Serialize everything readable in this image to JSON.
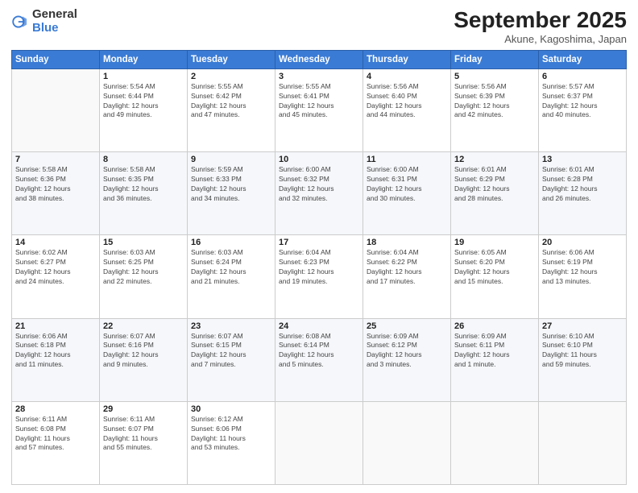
{
  "logo": {
    "general": "General",
    "blue": "Blue"
  },
  "title": "September 2025",
  "subtitle": "Akune, Kagoshima, Japan",
  "weekdays": [
    "Sunday",
    "Monday",
    "Tuesday",
    "Wednesday",
    "Thursday",
    "Friday",
    "Saturday"
  ],
  "weeks": [
    [
      {
        "day": "",
        "info": ""
      },
      {
        "day": "1",
        "info": "Sunrise: 5:54 AM\nSunset: 6:44 PM\nDaylight: 12 hours\nand 49 minutes."
      },
      {
        "day": "2",
        "info": "Sunrise: 5:55 AM\nSunset: 6:42 PM\nDaylight: 12 hours\nand 47 minutes."
      },
      {
        "day": "3",
        "info": "Sunrise: 5:55 AM\nSunset: 6:41 PM\nDaylight: 12 hours\nand 45 minutes."
      },
      {
        "day": "4",
        "info": "Sunrise: 5:56 AM\nSunset: 6:40 PM\nDaylight: 12 hours\nand 44 minutes."
      },
      {
        "day": "5",
        "info": "Sunrise: 5:56 AM\nSunset: 6:39 PM\nDaylight: 12 hours\nand 42 minutes."
      },
      {
        "day": "6",
        "info": "Sunrise: 5:57 AM\nSunset: 6:37 PM\nDaylight: 12 hours\nand 40 minutes."
      }
    ],
    [
      {
        "day": "7",
        "info": "Sunrise: 5:58 AM\nSunset: 6:36 PM\nDaylight: 12 hours\nand 38 minutes."
      },
      {
        "day": "8",
        "info": "Sunrise: 5:58 AM\nSunset: 6:35 PM\nDaylight: 12 hours\nand 36 minutes."
      },
      {
        "day": "9",
        "info": "Sunrise: 5:59 AM\nSunset: 6:33 PM\nDaylight: 12 hours\nand 34 minutes."
      },
      {
        "day": "10",
        "info": "Sunrise: 6:00 AM\nSunset: 6:32 PM\nDaylight: 12 hours\nand 32 minutes."
      },
      {
        "day": "11",
        "info": "Sunrise: 6:00 AM\nSunset: 6:31 PM\nDaylight: 12 hours\nand 30 minutes."
      },
      {
        "day": "12",
        "info": "Sunrise: 6:01 AM\nSunset: 6:29 PM\nDaylight: 12 hours\nand 28 minutes."
      },
      {
        "day": "13",
        "info": "Sunrise: 6:01 AM\nSunset: 6:28 PM\nDaylight: 12 hours\nand 26 minutes."
      }
    ],
    [
      {
        "day": "14",
        "info": "Sunrise: 6:02 AM\nSunset: 6:27 PM\nDaylight: 12 hours\nand 24 minutes."
      },
      {
        "day": "15",
        "info": "Sunrise: 6:03 AM\nSunset: 6:25 PM\nDaylight: 12 hours\nand 22 minutes."
      },
      {
        "day": "16",
        "info": "Sunrise: 6:03 AM\nSunset: 6:24 PM\nDaylight: 12 hours\nand 21 minutes."
      },
      {
        "day": "17",
        "info": "Sunrise: 6:04 AM\nSunset: 6:23 PM\nDaylight: 12 hours\nand 19 minutes."
      },
      {
        "day": "18",
        "info": "Sunrise: 6:04 AM\nSunset: 6:22 PM\nDaylight: 12 hours\nand 17 minutes."
      },
      {
        "day": "19",
        "info": "Sunrise: 6:05 AM\nSunset: 6:20 PM\nDaylight: 12 hours\nand 15 minutes."
      },
      {
        "day": "20",
        "info": "Sunrise: 6:06 AM\nSunset: 6:19 PM\nDaylight: 12 hours\nand 13 minutes."
      }
    ],
    [
      {
        "day": "21",
        "info": "Sunrise: 6:06 AM\nSunset: 6:18 PM\nDaylight: 12 hours\nand 11 minutes."
      },
      {
        "day": "22",
        "info": "Sunrise: 6:07 AM\nSunset: 6:16 PM\nDaylight: 12 hours\nand 9 minutes."
      },
      {
        "day": "23",
        "info": "Sunrise: 6:07 AM\nSunset: 6:15 PM\nDaylight: 12 hours\nand 7 minutes."
      },
      {
        "day": "24",
        "info": "Sunrise: 6:08 AM\nSunset: 6:14 PM\nDaylight: 12 hours\nand 5 minutes."
      },
      {
        "day": "25",
        "info": "Sunrise: 6:09 AM\nSunset: 6:12 PM\nDaylight: 12 hours\nand 3 minutes."
      },
      {
        "day": "26",
        "info": "Sunrise: 6:09 AM\nSunset: 6:11 PM\nDaylight: 12 hours\nand 1 minute."
      },
      {
        "day": "27",
        "info": "Sunrise: 6:10 AM\nSunset: 6:10 PM\nDaylight: 11 hours\nand 59 minutes."
      }
    ],
    [
      {
        "day": "28",
        "info": "Sunrise: 6:11 AM\nSunset: 6:08 PM\nDaylight: 11 hours\nand 57 minutes."
      },
      {
        "day": "29",
        "info": "Sunrise: 6:11 AM\nSunset: 6:07 PM\nDaylight: 11 hours\nand 55 minutes."
      },
      {
        "day": "30",
        "info": "Sunrise: 6:12 AM\nSunset: 6:06 PM\nDaylight: 11 hours\nand 53 minutes."
      },
      {
        "day": "",
        "info": ""
      },
      {
        "day": "",
        "info": ""
      },
      {
        "day": "",
        "info": ""
      },
      {
        "day": "",
        "info": ""
      }
    ]
  ]
}
